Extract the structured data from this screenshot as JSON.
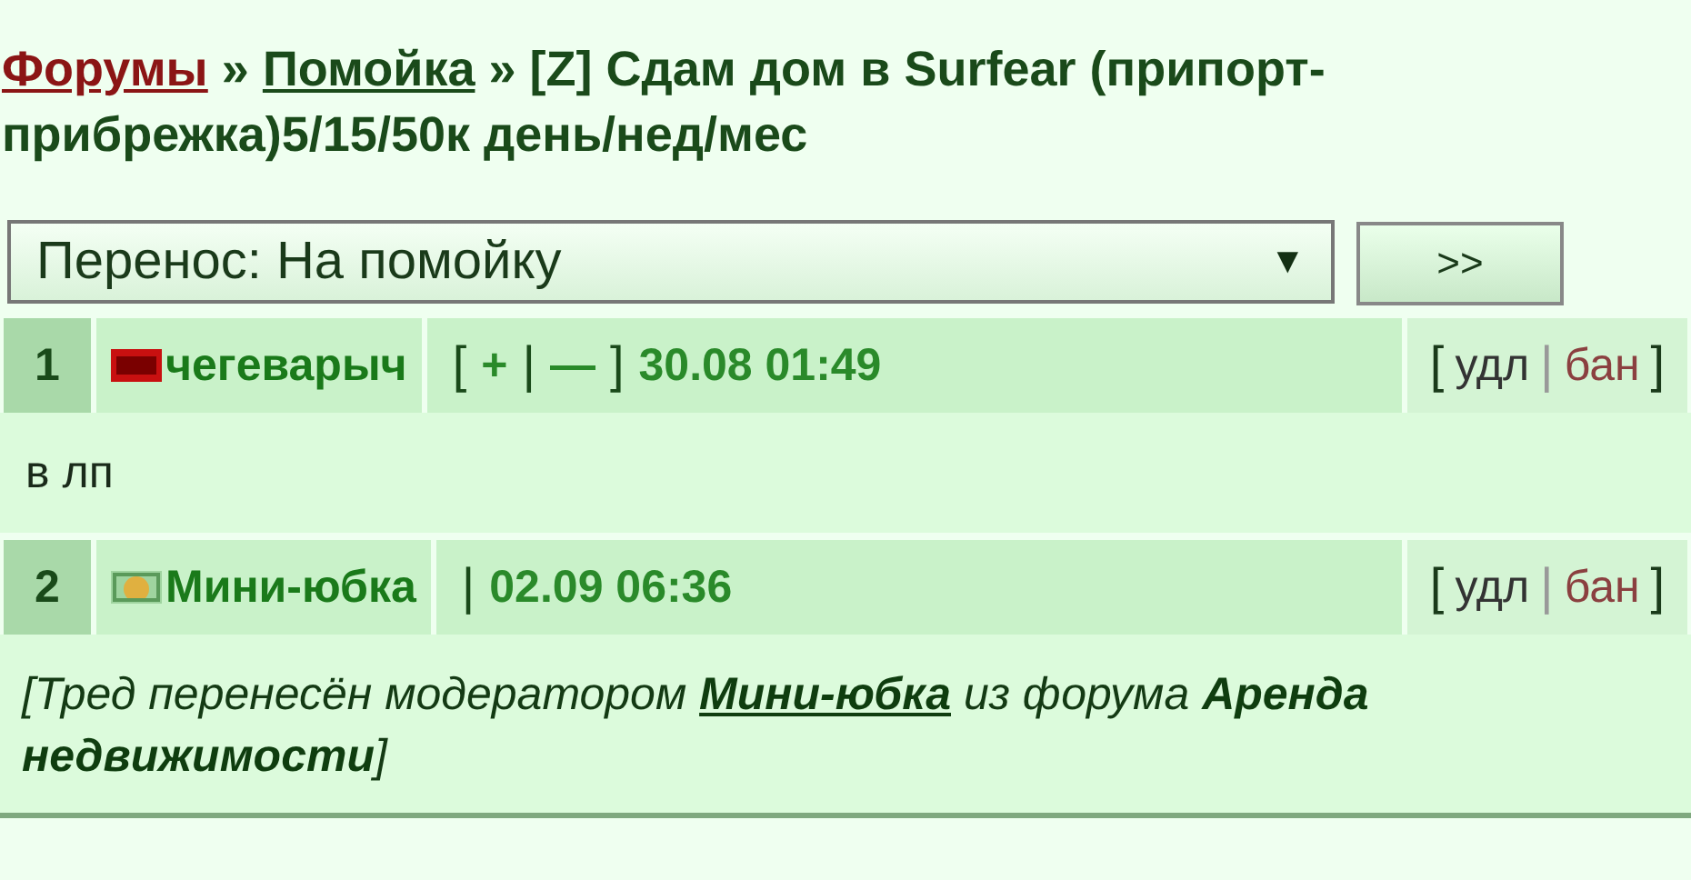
{
  "breadcrumb": {
    "links": [
      {
        "text": "Форумы",
        "kind": "visited"
      },
      {
        "text": "Помойка",
        "kind": "link"
      }
    ],
    "separator": "»",
    "title_lines": [
      "[Z] Сдам дом в Surfear (припорт-",
      "прибрежка)5/15/50к день/нед/мес"
    ]
  },
  "move": {
    "value": "Перенос: На помойку",
    "arrow": "▼",
    "button": ">>"
  },
  "posts": [
    {
      "number": "1",
      "avatar": {
        "kind": "red"
      },
      "author": "чегеварыч",
      "vote": {
        "open": "[",
        "plus": "+",
        "sep": "|",
        "minus": "—",
        "close": "]"
      },
      "time": "30.08 01:49",
      "actions": {
        "open": "[",
        "delete": "удл",
        "sep": "|",
        "ban": "бан",
        "close": "]"
      },
      "body": {
        "kind": "plain",
        "parts": [
          {
            "kind": "text",
            "text": "в лп"
          }
        ]
      }
    },
    {
      "number": "2",
      "avatar": {
        "kind": "yellow"
      },
      "author": "Мини-юбка",
      "separator": "|",
      "time": "02.09 06:36",
      "actions": {
        "open": "[",
        "delete": "удл",
        "sep": "|",
        "ban": "бан",
        "close": "]"
      },
      "body": {
        "kind": "note",
        "parts": [
          {
            "kind": "text",
            "text": "[Тред перенесён модератором "
          },
          {
            "kind": "link",
            "text": "Мини-юбка"
          },
          {
            "kind": "text",
            "text": " из форума **Аренда недвижимости**]"
          }
        ]
      }
    }
  ]
}
